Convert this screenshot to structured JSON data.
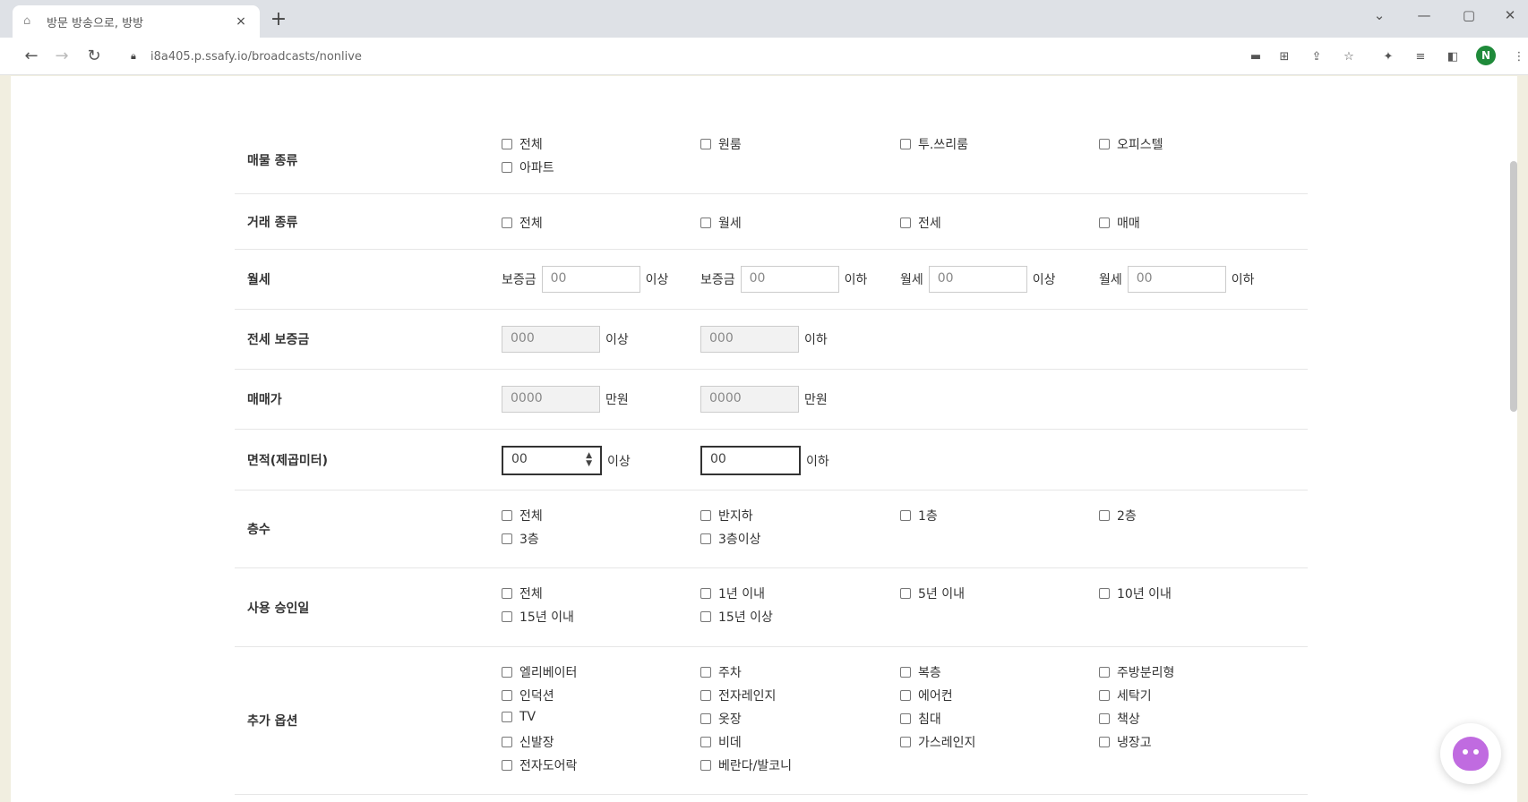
{
  "browser": {
    "tab_title": "방문 방송으로, 방방",
    "tab_close": "×",
    "new_tab": "+",
    "url": "i8a405.p.ssafy.io/broadcasts/nonlive",
    "win_min": "—",
    "win_max": "▢",
    "win_close": "✕",
    "tab_menu": "⌄",
    "profile_initial": "N"
  },
  "form": {
    "room_type": {
      "label": "매물 종류",
      "options": [
        "전체",
        "원룸",
        "투.쓰리룸",
        "오피스텔",
        "아파트"
      ]
    },
    "deal_type": {
      "label": "거래 종류",
      "options": [
        "전체",
        "월세",
        "전세",
        "매매"
      ]
    },
    "monthly": {
      "label": "월세",
      "fields": [
        {
          "prefix": "보증금",
          "value": "00",
          "suffix": "이상"
        },
        {
          "prefix": "보증금",
          "value": "00",
          "suffix": "이하"
        },
        {
          "prefix": "월세",
          "value": "00",
          "suffix": "이상"
        },
        {
          "prefix": "월세",
          "value": "00",
          "suffix": "이하"
        }
      ]
    },
    "jeonse": {
      "label": "전세 보증금",
      "fields": [
        {
          "value": "000",
          "suffix": "이상"
        },
        {
          "value": "000",
          "suffix": "이하"
        }
      ]
    },
    "sale": {
      "label": "매매가",
      "fields": [
        {
          "value": "0000",
          "suffix": "만원"
        },
        {
          "value": "0000",
          "suffix": "만원"
        }
      ]
    },
    "area": {
      "label": "면적(제곱미터)",
      "fields": [
        {
          "value": "00",
          "suffix": "이상"
        },
        {
          "value": "00",
          "suffix": "이하"
        }
      ]
    },
    "floor": {
      "label": "층수",
      "options": [
        "전체",
        "반지하",
        "1층",
        "2층",
        "3층",
        "3층이상"
      ]
    },
    "approval": {
      "label": "사용 승인일",
      "options": [
        "전체",
        "1년 이내",
        "5년 이내",
        "10년 이내",
        "15년 이내",
        "15년 이상"
      ]
    },
    "extra": {
      "label": "추가 옵션",
      "options": [
        "엘리베이터",
        "주차",
        "복층",
        "주방분리형",
        "인덕션",
        "전자레인지",
        "에어컨",
        "세탁기",
        "TV",
        "옷장",
        "침대",
        "책상",
        "신발장",
        "비데",
        "가스레인지",
        "냉장고",
        "전자도어락",
        "베란다/발코니"
      ]
    }
  }
}
